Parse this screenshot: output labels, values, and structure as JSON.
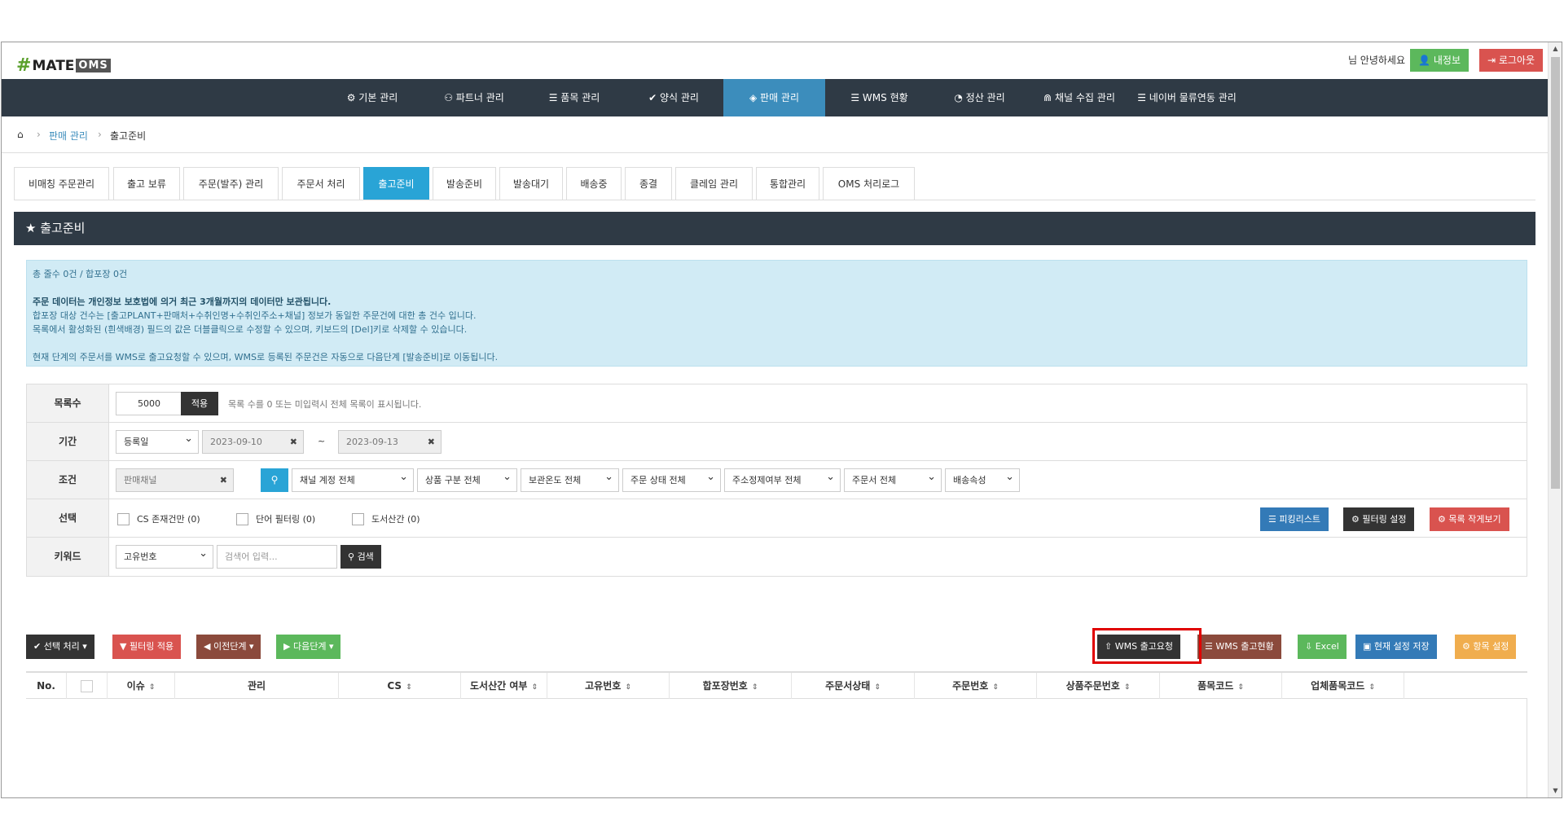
{
  "header": {
    "logo_prefix": "#",
    "logo_main": "MATE",
    "logo_suffix": "OMS",
    "greeting": "님 안녕하세요",
    "my_info_label": "내정보",
    "logout_label": "로그아웃"
  },
  "nav": {
    "items": [
      {
        "label": "기본 관리",
        "icon": "gear-icon"
      },
      {
        "label": "파트너 관리",
        "icon": "user-icon"
      },
      {
        "label": "품목 관리",
        "icon": "list-icon"
      },
      {
        "label": "양식 관리",
        "icon": "check-icon"
      },
      {
        "label": "판매 관리",
        "icon": "diamond-icon"
      },
      {
        "label": "WMS 현황",
        "icon": "list-icon"
      },
      {
        "label": "정산 관리",
        "icon": "pie-icon"
      },
      {
        "label": "채널 수집 관리",
        "icon": "rss-icon"
      },
      {
        "label": "네이버 물류연동 관리",
        "icon": "list-icon"
      }
    ],
    "active": "판매 관리"
  },
  "breadcrumb": {
    "home_icon": "home-icon",
    "level1": "판매 관리",
    "level2": "출고준비"
  },
  "tabs": [
    "비매칭 주문관리",
    "출고 보류",
    "주문(발주) 관리",
    "주문서 처리",
    "출고준비",
    "발송준비",
    "발송대기",
    "배송중",
    "종결",
    "클레임 관리",
    "통합관리",
    "OMS 처리로그"
  ],
  "active_tab": "출고준비",
  "section": {
    "title": "출고준비",
    "icon": "star-icon"
  },
  "info": {
    "line1": "총 줄수 0건 / 합포장 0건",
    "line2": "주문 데이터는 개인정보 보호법에 의거 최근 3개월까지의 데이터만 보관됩니다.",
    "line3": "합포장 대상 건수는 [출고PLANT+판매처+수취인명+수취인주소+채널] 정보가 동일한 주문건에 대한 총 건수 입니다.",
    "line4": "목록에서 활성화된 (흰색배경) 필드의 값은 더블클릭으로 수정할 수 있으며, 키보드의 [Del]키로 삭제할 수 있습니다.",
    "line5": "현재 단계의 주문서를 WMS로 출고요청할 수 있으며, WMS로 등록된 주문건은 자동으로 다음단계 [발송준비]로 이동됩니다."
  },
  "filter": {
    "rows": {
      "count_label": "목록수",
      "period_label": "기간",
      "condition_label": "조건",
      "select_label": "선택",
      "keyword_label": "키워드"
    },
    "count_value": "5000",
    "apply_label": "적용",
    "count_hint": "목록 수를 0 또는 미입력시 전체 목록이 표시됩니다.",
    "period_type": "등록일",
    "date_from": "2023-09-10",
    "date_sep": "~",
    "date_to": "2023-09-13",
    "channel_placeholder": "판매채널",
    "conditions": [
      "채널 계정 전체",
      "상품 구분 전체",
      "보관온도 전체",
      "주문 상태 전체",
      "주소정제여부 전체",
      "주문서 전체",
      "배송속성"
    ],
    "checks": [
      "CS 존재건만 (0)",
      "단어 필터링 (0)",
      "도서산간 (0)"
    ],
    "right_buttons": {
      "picking": "피킹리스트",
      "filter_setting": "필터링 설정",
      "small_view": "목록 작게보기"
    },
    "keyword_type": "고유번호",
    "keyword_placeholder": "검색어 입력...",
    "search_label": "검색"
  },
  "actions": {
    "select_process": "선택 처리",
    "filter_apply": "필터링 적용",
    "prev_step": "이전단계",
    "next_step": "다음단계",
    "wms_request": "WMS 출고요청",
    "wms_status": "WMS 출고현황",
    "excel": "Excel",
    "save_setting": "현재 설정 저장",
    "item_setting": "항목 설정"
  },
  "colors": {
    "nav_bg": "#2f3a45",
    "nav_active": "#3c8dbc",
    "tab_active": "#29a4d6",
    "info_bg": "#d1ebf5",
    "highlight": "#e00000"
  },
  "table": {
    "columns": [
      "No.",
      "",
      "이슈",
      "관리",
      "CS",
      "도서산간 여부",
      "고유번호",
      "합포장번호",
      "주문서상태",
      "주문번호",
      "상품주문번호",
      "품목코드",
      "업체품목코드"
    ]
  }
}
